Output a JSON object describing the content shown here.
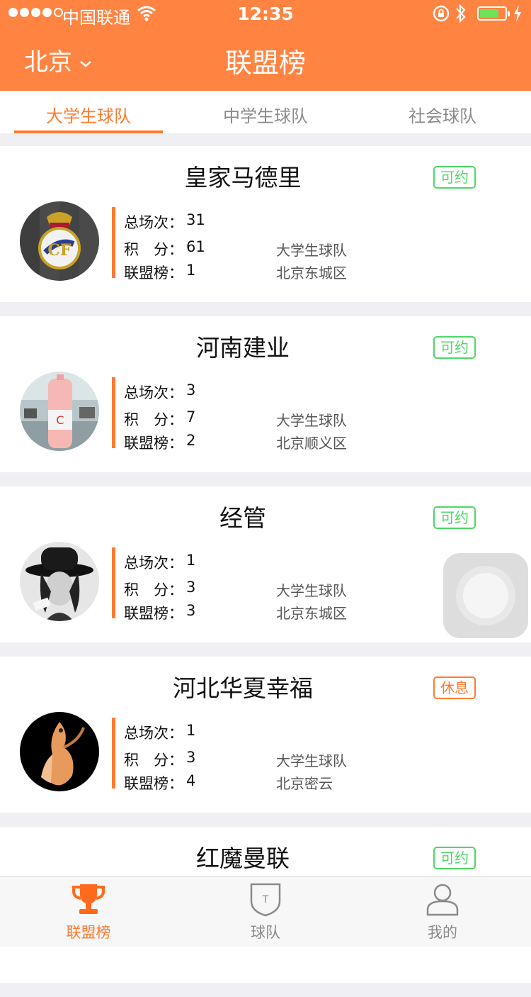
{
  "status_bar": {
    "carrier": "中国联通",
    "time": "12:35",
    "battery_color": "#6ee25a"
  },
  "nav": {
    "city": "北京",
    "title": "联盟榜"
  },
  "tabs": [
    {
      "label": "大学生球队",
      "active": true
    },
    {
      "label": "中学生球队",
      "active": false
    },
    {
      "label": "社会球队",
      "active": false
    }
  ],
  "labels": {
    "total_games": "总场次：",
    "points": "积　分：",
    "rank": "联盟榜："
  },
  "teams": [
    {
      "name": "皇家马德里",
      "status": "可约",
      "games": "31",
      "points": "61",
      "rank": "1",
      "category": "大学生球队",
      "location": "北京东城区"
    },
    {
      "name": "河南建业",
      "status": "可约",
      "games": "3",
      "points": "7",
      "rank": "2",
      "category": "大学生球队",
      "location": "北京顺义区"
    },
    {
      "name": "经管",
      "status": "可约",
      "games": "1",
      "points": "3",
      "rank": "3",
      "category": "大学生球队",
      "location": "北京东城区"
    },
    {
      "name": "河北华夏幸福",
      "status": "休息",
      "games": "1",
      "points": "3",
      "rank": "4",
      "category": "大学生球队",
      "location": "北京密云"
    },
    {
      "name": "红魔曼联",
      "status": "可约"
    }
  ],
  "tabbar": [
    {
      "label": "联盟榜",
      "icon": "trophy-icon",
      "active": true
    },
    {
      "label": "球队",
      "icon": "shield-icon",
      "active": false
    },
    {
      "label": "我的",
      "icon": "user-icon",
      "active": false
    }
  ],
  "colors": {
    "accent": "#ff8442",
    "available": "#4cd964",
    "rest": "#ff7a30"
  }
}
